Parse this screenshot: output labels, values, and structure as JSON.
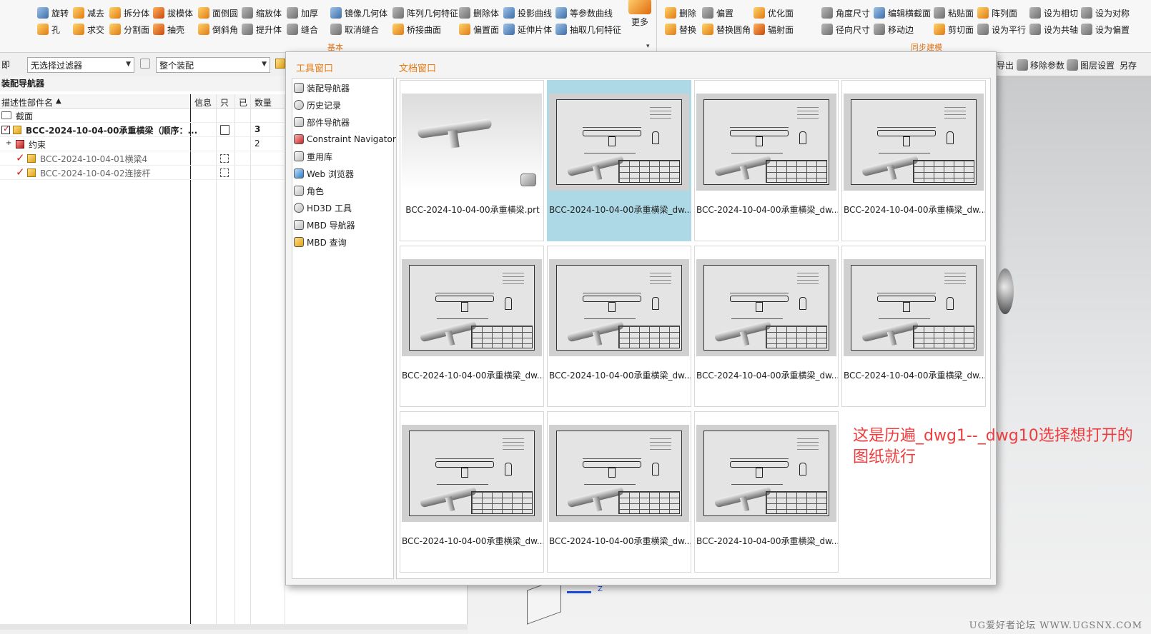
{
  "ribbon": {
    "row1": [
      "旋转",
      "减去",
      "拆分体",
      "拔模体",
      "面倒圆",
      "缩放体",
      "加厚",
      "镜像几何体",
      "阵列几何特征",
      "删除体",
      "投影曲线",
      "等参数曲线"
    ],
    "row2": [
      "孔",
      "求交",
      "分割面",
      "抽壳",
      "倒斜角",
      "提升体",
      "缝合",
      "取消缝合",
      "桥接曲面",
      "偏置面",
      "延伸片体",
      "抽取几何特征"
    ],
    "more_label": "更多",
    "group_basic": "基本",
    "sync_row1": [
      "删除",
      "偏置",
      "优化面",
      "角度尺寸",
      "编辑横截面",
      "粘贴面",
      "阵列面",
      "设为相切",
      "设为对称"
    ],
    "sync_row2": [
      "替换",
      "替换圆角",
      "辐射面",
      "径向尺寸",
      "移动边",
      "剪切面",
      "设为平行",
      "设为共轴",
      "设为偏置"
    ],
    "group_sync": "同步建模"
  },
  "toolbar": {
    "prefix": "即",
    "filter_value": "无选择过滤器",
    "scope_value": "整个装配",
    "right_items": [
      "导出",
      "移除参数",
      "图层设置",
      "另存"
    ]
  },
  "navigator": {
    "title": "装配导航器",
    "columns": [
      "描述性部件名",
      "信息",
      "只",
      "已",
      "数量"
    ],
    "rows": [
      {
        "label": "截面",
        "count": ""
      },
      {
        "label": "BCC-2024-10-04-00承重横梁（顺序：...",
        "count": "3"
      },
      {
        "label": "约束",
        "count": "2"
      },
      {
        "label": "BCC-2024-10-04-01横梁4",
        "count": ""
      },
      {
        "label": "BCC-2024-10-04-02连接杆",
        "count": ""
      }
    ]
  },
  "popup": {
    "tools_title": "工具窗口",
    "docs_title": "文档窗口",
    "tools": [
      "装配导航器",
      "历史记录",
      "部件导航器",
      "Constraint Navigator",
      "重用库",
      "Web 浏览器",
      "角色",
      "HD3D 工具",
      "MBD 导航器",
      "MBD 查询"
    ],
    "documents": [
      {
        "label": "BCC-2024-10-04-00承重横梁.prt",
        "kind": "model",
        "selected": false
      },
      {
        "label": "BCC-2024-10-04-00承重横梁_dw...",
        "kind": "drawing",
        "selected": true
      },
      {
        "label": "BCC-2024-10-04-00承重横梁_dw...",
        "kind": "drawing",
        "selected": false
      },
      {
        "label": "BCC-2024-10-04-00承重横梁_dw...",
        "kind": "drawing",
        "selected": false
      },
      {
        "label": "BCC-2024-10-04-00承重横梁_dw...",
        "kind": "drawing",
        "selected": false
      },
      {
        "label": "BCC-2024-10-04-00承重横梁_dw...",
        "kind": "drawing",
        "selected": false
      },
      {
        "label": "BCC-2024-10-04-00承重横梁_dw...",
        "kind": "drawing",
        "selected": false
      },
      {
        "label": "BCC-2024-10-04-00承重横梁_dw...",
        "kind": "drawing",
        "selected": false
      },
      {
        "label": "BCC-2024-10-04-00承重横梁_dw...",
        "kind": "drawing",
        "selected": false
      },
      {
        "label": "BCC-2024-10-04-00承重横梁_dw...",
        "kind": "drawing",
        "selected": false
      },
      {
        "label": "BCC-2024-10-04-00承重横梁_dw...",
        "kind": "drawing",
        "selected": false
      }
    ]
  },
  "annotation": "这是历遍_dwg1--_dwg10选择想打开的图纸就行",
  "viewport": {
    "axis_label": "Z"
  },
  "watermark": "UG爱好者论坛 WWW.UGSNX.COM",
  "colors": {
    "accent": "#e8790f",
    "selection": "#add8e6",
    "annotation": "#f03c3c"
  }
}
